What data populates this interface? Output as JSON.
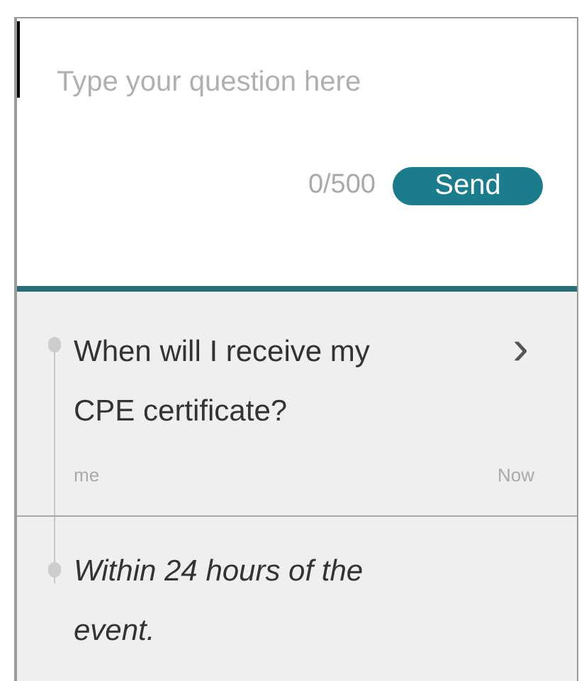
{
  "composer": {
    "placeholder": "Type your question here",
    "counter": "0/500",
    "send_button": "Send"
  },
  "messages": [
    {
      "kind": "question",
      "text": "When will I receive my CPE certificate?",
      "chevron": "›",
      "author": "me",
      "time": "Now"
    },
    {
      "kind": "answer",
      "text": "Within 24 hours of the event."
    }
  ]
}
